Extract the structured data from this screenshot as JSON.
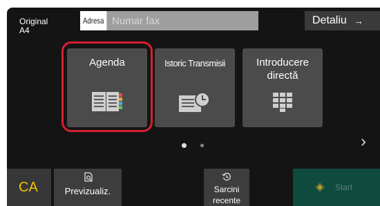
{
  "header": {
    "original_line1": "Original",
    "original_line2": "A4",
    "address_tag": "Adresa",
    "address_placeholder": "Numar fax",
    "detail_label": "Detaliu",
    "detail_arrow": "→"
  },
  "functions": [
    {
      "label": "Agenda",
      "icon": "address-book-icon"
    },
    {
      "label": "Istoric Transmisii",
      "icon": "transmission-history-icon"
    },
    {
      "label_line1": "Introducere",
      "label_line2": "directă",
      "icon": "keypad-icon"
    }
  ],
  "pager": {
    "pages": 2,
    "current": 1,
    "next_icon": "chevron-right-icon"
  },
  "bottom": {
    "ca_label": "CA",
    "preview_label": "Previzualiz.",
    "preview_icon": "preview-icon",
    "recent_line1": "Sarcini",
    "recent_line2": "recente",
    "recent_icon": "history-icon",
    "start_label": "Start",
    "start_icon": "start-diamond-icon"
  },
  "colors": {
    "highlight": "#d81f30",
    "ca": "#f2c200",
    "start_bg": "#0f4a3f"
  }
}
